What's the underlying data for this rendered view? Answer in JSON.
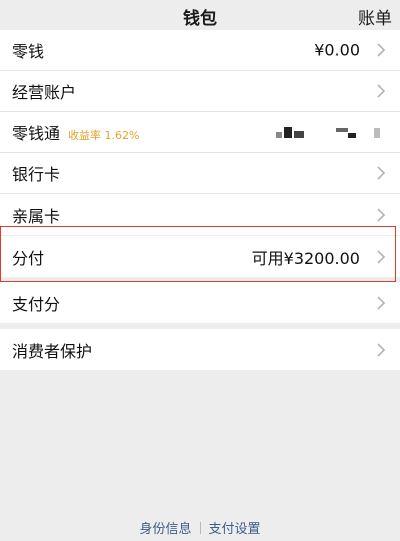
{
  "header": {
    "title": "钱包",
    "bill_label": "账单"
  },
  "group1": {
    "items": [
      {
        "label": "零钱",
        "value": "¥0.00"
      },
      {
        "label": "经营账户",
        "value": ""
      },
      {
        "label": "零钱通",
        "sub": "收益率 1.62%"
      },
      {
        "label": "银行卡",
        "value": ""
      },
      {
        "label": "亲属卡",
        "value": ""
      }
    ]
  },
  "group2": {
    "items": [
      {
        "label": "分付",
        "value": "可用¥3200.00"
      }
    ]
  },
  "group3": {
    "items": [
      {
        "label": "支付分",
        "value": ""
      }
    ]
  },
  "group4": {
    "items": [
      {
        "label": "消费者保护",
        "value": ""
      }
    ]
  },
  "footer": {
    "links": [
      "身份信息",
      "支付设置"
    ]
  },
  "colors": {
    "accent_highlight": "#e2392b",
    "yield_text": "#e3a32a",
    "footer_link": "#3e5d8a"
  }
}
